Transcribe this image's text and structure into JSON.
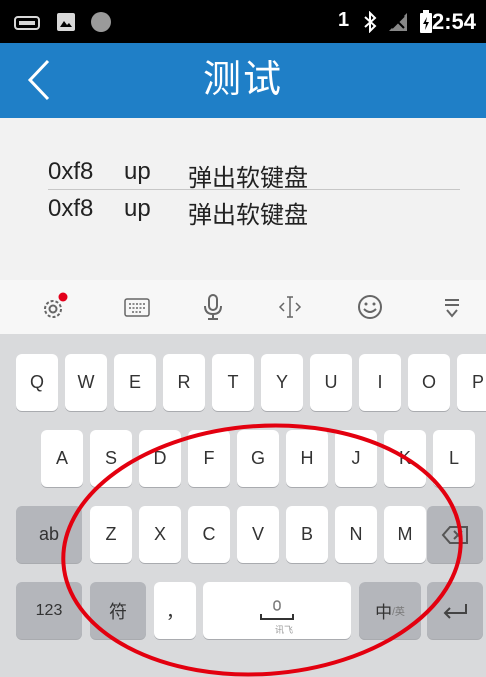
{
  "status_bar": {
    "sim": "1",
    "time": "2:54"
  },
  "title_bar": {
    "title": "测试"
  },
  "log": [
    {
      "code": "0xf8",
      "action": "up",
      "message": "弹出软键盘"
    },
    {
      "code": "0xf8",
      "action": "up",
      "message": "弹出软键盘"
    }
  ],
  "keyboard": {
    "row1": [
      "Q",
      "W",
      "E",
      "R",
      "T",
      "Y",
      "U",
      "I",
      "O",
      "P"
    ],
    "row2": [
      "A",
      "S",
      "D",
      "F",
      "G",
      "H",
      "J",
      "K",
      "L"
    ],
    "row3": {
      "shift": "ab",
      "letters": [
        "Z",
        "X",
        "C",
        "V",
        "B",
        "N",
        "M"
      ]
    },
    "row4": {
      "numbers": "123",
      "symbols": "符",
      "comma": "，",
      "space_sub": "讯飞",
      "period": "。",
      "lang": "中",
      "lang_sub": "/英"
    }
  },
  "accent_colors": {
    "title_bar": "#1f7fc7",
    "annotation": "#e3000f",
    "notification_dot": "#e3001b"
  }
}
